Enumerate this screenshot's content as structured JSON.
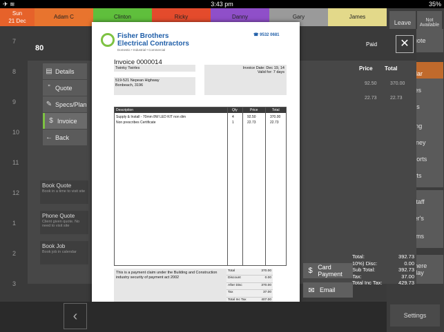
{
  "status": {
    "time": "3:43 pm",
    "battery": "35%"
  },
  "calendar": {
    "sun_day": "Sun",
    "sun_date": "21 Dec",
    "staff": [
      {
        "name": "Adam C",
        "color": "#e8742e"
      },
      {
        "name": "Clinton",
        "color": "#5fbf3c"
      },
      {
        "name": "Ricky",
        "color": "#e44b2c"
      },
      {
        "name": "Danny",
        "color": "#8f4fc9"
      },
      {
        "name": "Gary",
        "color": "#9a9a9a"
      },
      {
        "name": "James",
        "color": "#e3d98a"
      }
    ],
    "times": [
      "7",
      "8",
      "9",
      "10",
      "11",
      "12",
      "1",
      "2",
      "3",
      "4"
    ]
  },
  "right_panel": {
    "leave": "Leave",
    "not_available": "Not Available",
    "quote": "/Quote",
    "calendar": "ndar",
    "quotes": "ites",
    "jobs": "bs",
    "invoicing": "cing",
    "money": "Money",
    "exports": "Exports",
    "reports": "orts",
    "staff": "/ Staff",
    "customers": "mer's",
    "items": "Items",
    "book_here": "ob here\nit day"
  },
  "job": {
    "number": "80",
    "paid": "Paid",
    "nav": [
      {
        "icon": "▤",
        "label": "Details"
      },
      {
        "icon": "”",
        "label": "Quote"
      },
      {
        "icon": "✎",
        "label": "Specs/Plan"
      },
      {
        "icon": "$",
        "label": "Invoice"
      },
      {
        "icon": "←",
        "label": "Back"
      }
    ],
    "options": [
      {
        "title": "Book Quote",
        "sub": "Book in a time to visit site"
      },
      {
        "title": "Phone Quote",
        "sub": "Client given quote. No need to visit site"
      },
      {
        "title": "Book Job",
        "sub": "Book job in calendar"
      }
    ],
    "col_price": "Price",
    "col_total": "Total",
    "rows": [
      [
        "92.50",
        "370.00"
      ],
      [
        "22.73",
        "22.73"
      ]
    ],
    "totals": [
      {
        "label": "Total:",
        "value": "392.73"
      },
      {
        "label": "10%) Disc:",
        "value": "0.00"
      },
      {
        "label": "Sub Total:",
        "value": "392.73"
      },
      {
        "label": "Tax:",
        "value": "37.00"
      },
      {
        "label": "Total Inc Tax:",
        "value": "429.73"
      }
    ]
  },
  "invoice": {
    "company_line1": "Fisher Brothers",
    "company_line2": "Electrical Contractors",
    "tagline": "Domestic • Industrial • Commercial",
    "phone": "☎ 9532 0681",
    "title": "Invoice 0000014",
    "customer_name": "Twinky Twirles",
    "address_line1": "519-521 Nepean Highway",
    "address_line2": "Bonbeach, 3196",
    "invoice_date_label": "Invoice Date:",
    "invoice_date": "Dec 19, 14",
    "valid_label": "Valid for:",
    "valid_value": "7 days",
    "headers": {
      "description": "Description",
      "qty": "Qty",
      "price": "Price",
      "total": "Total"
    },
    "lines": [
      {
        "description": "Supply & Install - 70mm 8W LED KIT non dim",
        "qty": "4",
        "price": "92.50",
        "total": "370.00"
      },
      {
        "description": "Non prescribes Certificate",
        "qty": "1",
        "price": "22.73",
        "total": "22.73"
      }
    ],
    "payment_note": "This is a payment claim under the Building and Construction industry security of payment act 2002",
    "summary": [
      {
        "label": "Total",
        "value": "370.00"
      },
      {
        "label": "Discount",
        "value": "0.00"
      },
      {
        "label": "After Disc",
        "value": "370.00"
      },
      {
        "label": "Tax",
        "value": "37.00"
      },
      {
        "label": "Total Inc Tax",
        "value": "407.00"
      }
    ]
  },
  "actions": [
    {
      "icon": "$",
      "label": "Card Payment"
    },
    {
      "icon": "✉",
      "label": "Email"
    },
    {
      "icon": "✕",
      "label": "Close"
    }
  ],
  "bottom": {
    "back_icon": "‹",
    "settings": "Settings"
  }
}
